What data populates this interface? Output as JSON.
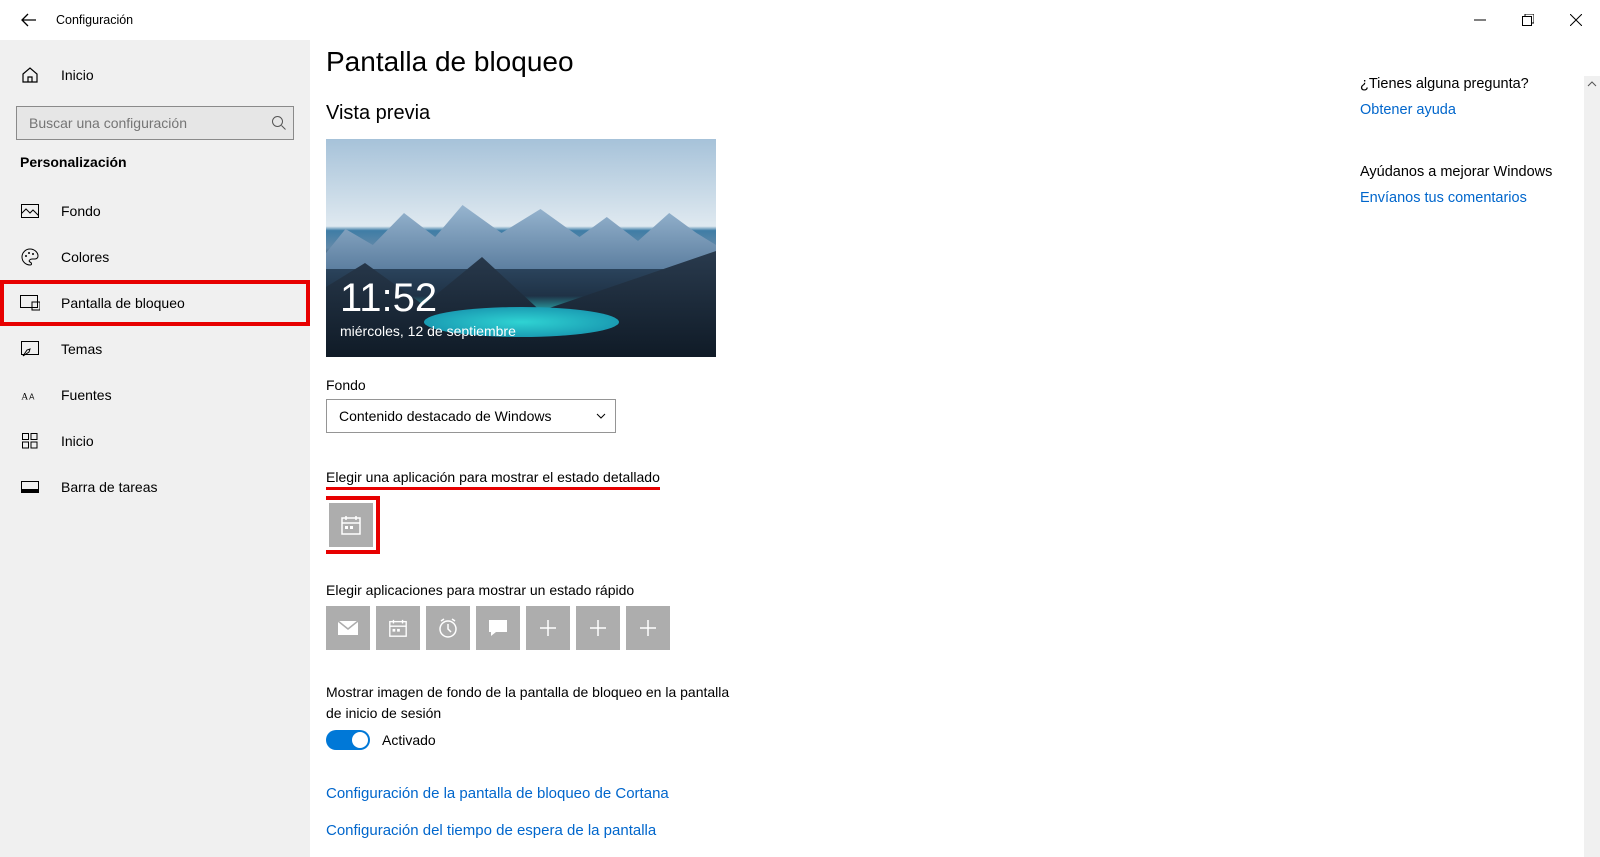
{
  "titlebar": {
    "title": "Configuración"
  },
  "sidebar": {
    "home": "Inicio",
    "search_placeholder": "Buscar una configuración",
    "category": "Personalización",
    "items": [
      {
        "id": "fondo",
        "label": "Fondo"
      },
      {
        "id": "colores",
        "label": "Colores"
      },
      {
        "id": "bloqueo",
        "label": "Pantalla de bloqueo"
      },
      {
        "id": "temas",
        "label": "Temas"
      },
      {
        "id": "fuentes",
        "label": "Fuentes"
      },
      {
        "id": "inicio",
        "label": "Inicio"
      },
      {
        "id": "barra",
        "label": "Barra de tareas"
      }
    ]
  },
  "page": {
    "title": "Pantalla de bloqueo",
    "preview_heading": "Vista previa",
    "preview_time": "11:52",
    "preview_date": "miércoles, 12 de septiembre",
    "background_label": "Fondo",
    "background_value": "Contenido destacado de Windows",
    "detailed_label": "Elegir una aplicación para mostrar el estado detallado",
    "detailed_app": "Calendario",
    "quick_label": "Elegir aplicaciones para mostrar un estado rápido",
    "quick_apps": [
      "mail",
      "calendar",
      "alarm",
      "chat",
      "add",
      "add",
      "add"
    ],
    "login_background_label": "Mostrar imagen de fondo de la pantalla de bloqueo en la pantalla de inicio de sesión",
    "toggle_state": "Activado",
    "links": [
      "Configuración de la pantalla de bloqueo de Cortana",
      "Configuración del tiempo de espera de la pantalla"
    ]
  },
  "right": {
    "question": "¿Tienes alguna pregunta?",
    "help": "Obtener ayuda",
    "improve": "Ayúdanos a mejorar Windows",
    "feedback": "Envíanos tus comentarios"
  }
}
